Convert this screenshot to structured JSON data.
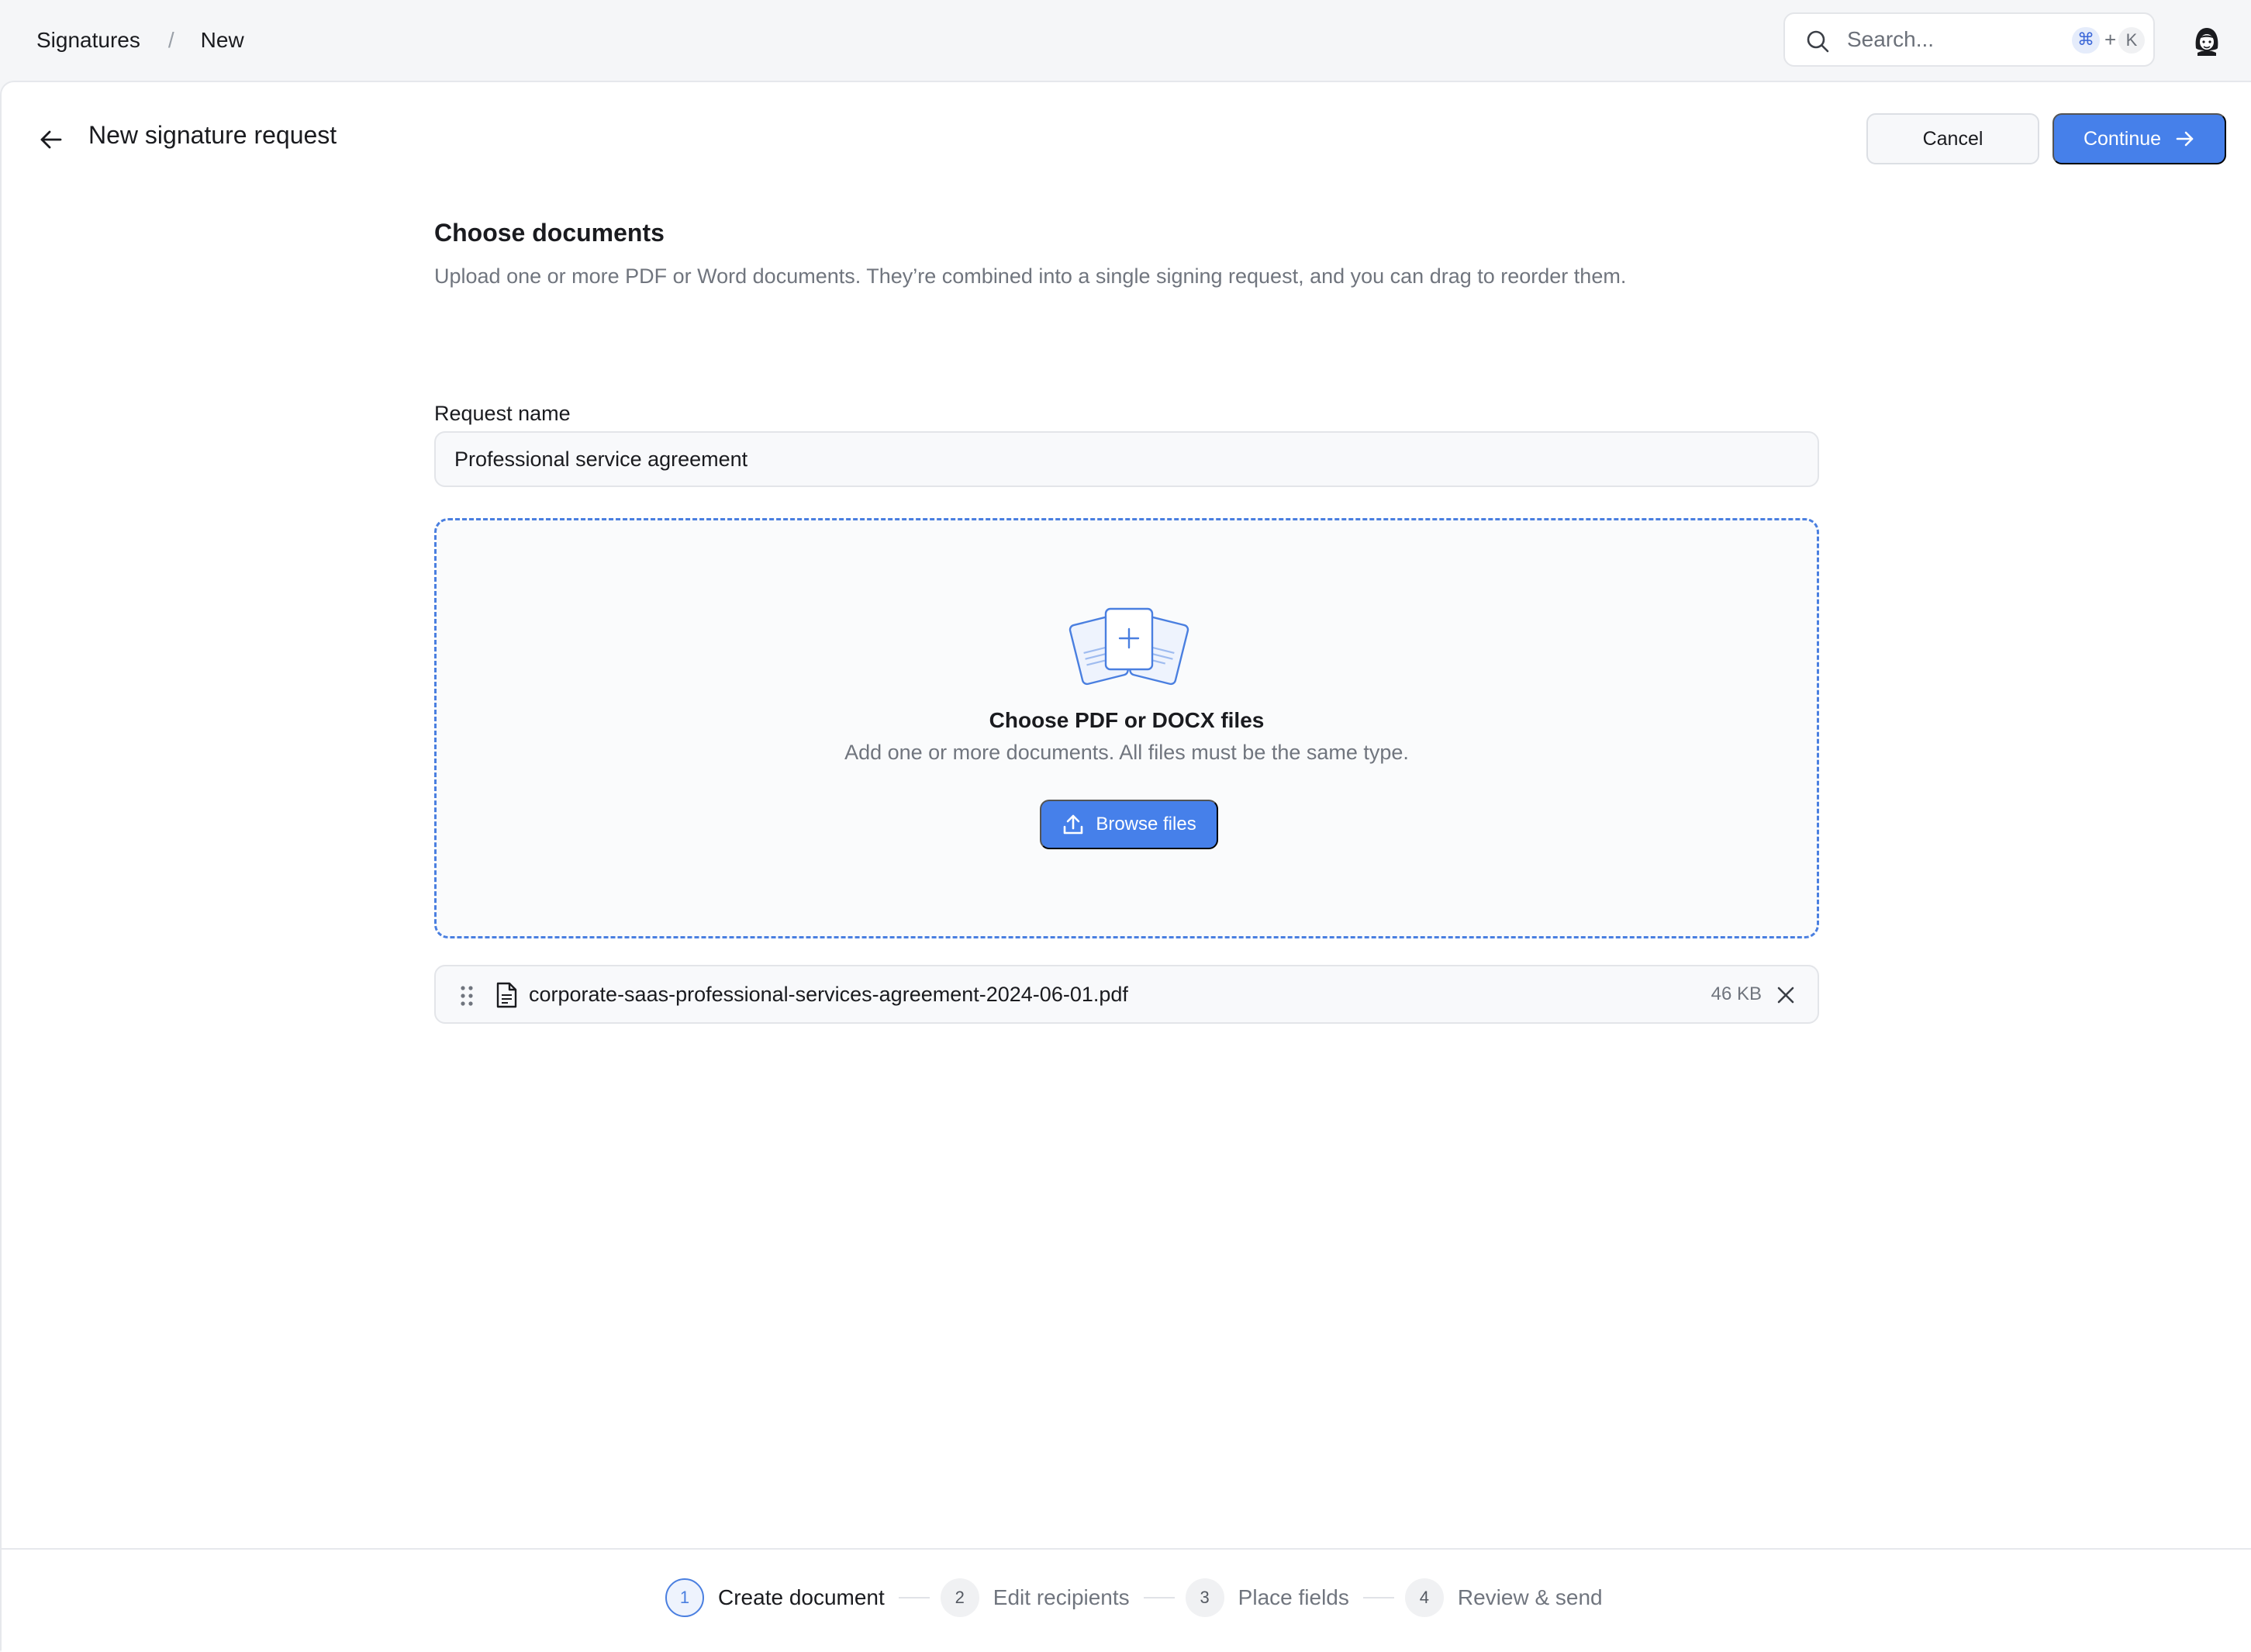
{
  "breadcrumb": {
    "root": "Signatures",
    "separator": "/",
    "current": "New"
  },
  "search": {
    "placeholder": "Search...",
    "shortcut_modifier": "⌘",
    "shortcut_plus": "+",
    "shortcut_key": "K"
  },
  "header": {
    "title": "New signature request",
    "cancel_label": "Cancel",
    "continue_label": "Continue"
  },
  "section": {
    "title": "Choose documents",
    "description": "Upload one or more PDF or Word documents. They’re combined into a single signing request, and you can drag to reorder them."
  },
  "request_name": {
    "label": "Request name",
    "value": "Professional service agreement"
  },
  "dropzone": {
    "title": "Choose PDF or DOCX files",
    "subtitle": "Add one or more documents. All files must be the same type.",
    "browse_label": "Browse files"
  },
  "files": [
    {
      "name": "corporate-saas-professional-services-agreement-2024-06-01.pdf",
      "size": "46 KB"
    }
  ],
  "steps": [
    {
      "number": "1",
      "label": "Create document",
      "active": true
    },
    {
      "number": "2",
      "label": "Edit recipients",
      "active": false
    },
    {
      "number": "3",
      "label": "Place fields",
      "active": false
    },
    {
      "number": "4",
      "label": "Review & send",
      "active": false
    }
  ],
  "colors": {
    "accent": "#4680ea",
    "accent_border": "#4a7fe0",
    "muted_text": "#70757e"
  }
}
